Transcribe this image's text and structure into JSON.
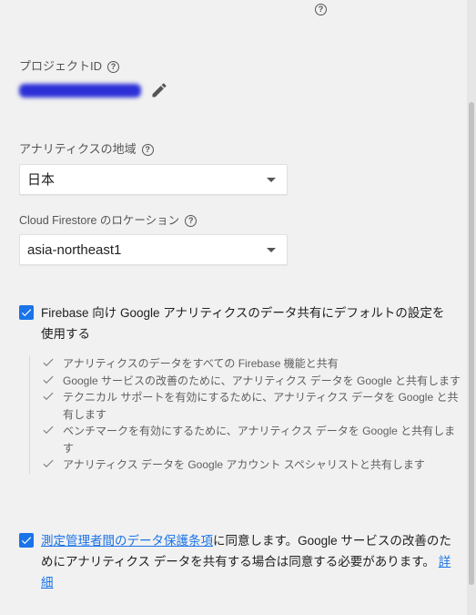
{
  "project_id": {
    "label": "プロジェクトID",
    "value": "mydotnetappe-627d3"
  },
  "analytics_region": {
    "label": "アナリティクスの地域",
    "value": "日本"
  },
  "firestore_location": {
    "label": "Cloud Firestore のロケーション",
    "value": "asia-northeast1"
  },
  "default_sharing": {
    "checked": true,
    "text": "Firebase 向け Google アナリティクスのデータ共有にデフォルトの設定を使用する",
    "bullets": [
      "アナリティクスのデータをすべての Firebase 機能と共有",
      "Google サービスの改善のために、アナリティクス データを Google と共有します",
      "テクニカル サポートを有効にするために、アナリティクス データを Google と共有します",
      "ベンチマークを有効にするために、アナリティクス データを Google と共有します",
      "アナリティクス データを Google アカウント スペシャリストと共有します"
    ]
  },
  "terms": {
    "checked": true,
    "link_text": "測定管理者間のデータ保護条項",
    "text": "に同意します。Google サービスの改善のためにアナリティクス データを共有する場合は同意する必要があります。",
    "details_link": "詳細"
  },
  "icons": {
    "help": "help-circle-icon",
    "edit": "pencil-icon",
    "check": "check-icon",
    "dropdown": "dropdown-arrow-icon"
  },
  "colors": {
    "accent": "#1a73e8",
    "background": "#f1f1f1"
  }
}
